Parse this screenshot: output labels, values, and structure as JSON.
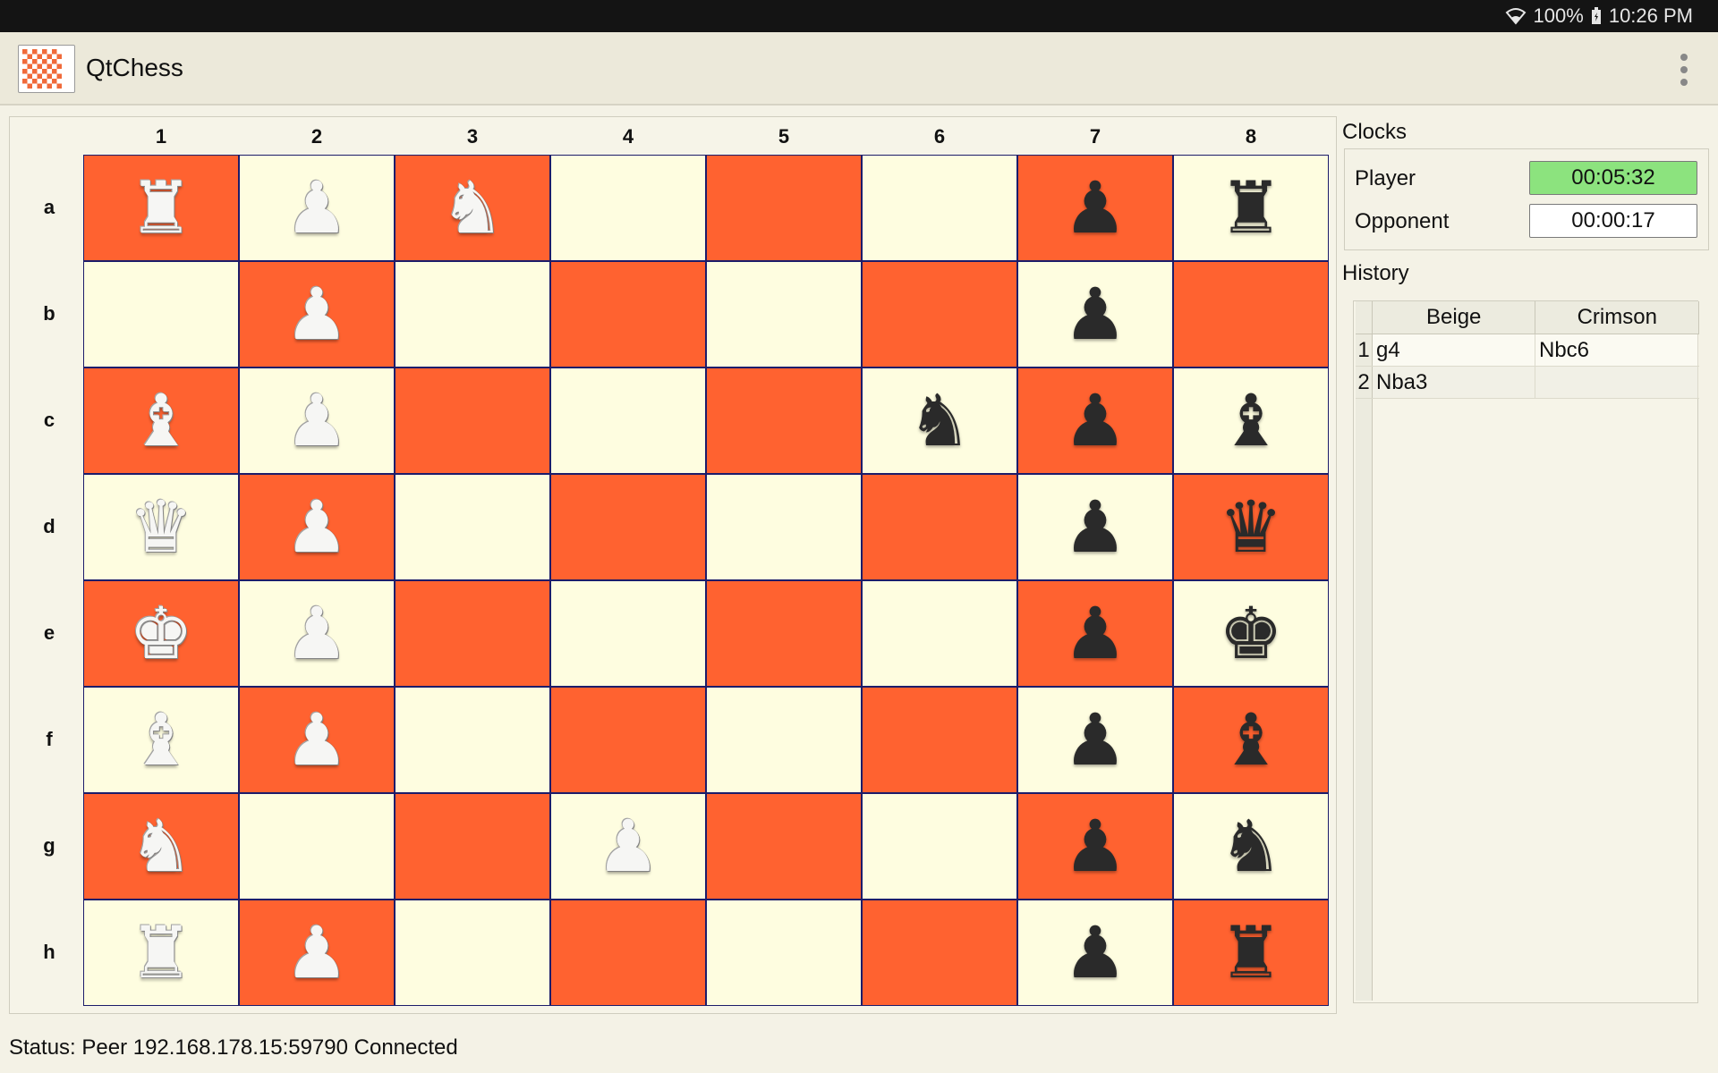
{
  "statusbar": {
    "battery": "100%",
    "time": "10:26 PM"
  },
  "app": {
    "title": "QtChess"
  },
  "board": {
    "columns": [
      "1",
      "2",
      "3",
      "4",
      "5",
      "6",
      "7",
      "8"
    ],
    "rows": [
      "a",
      "b",
      "c",
      "d",
      "e",
      "f",
      "g",
      "h"
    ],
    "pieces": [
      [
        "wR",
        "wP",
        "wN",
        "",
        "",
        "",
        "bP",
        "bR"
      ],
      [
        "",
        "wP",
        "",
        "",
        "",
        "",
        "bP",
        ""
      ],
      [
        "wB",
        "wP",
        "",
        "",
        "",
        "bN",
        "bP",
        "bB"
      ],
      [
        "wQ",
        "wP",
        "",
        "",
        "",
        "",
        "bP",
        "bQ"
      ],
      [
        "wK",
        "wP",
        "",
        "",
        "",
        "",
        "bP",
        "bK"
      ],
      [
        "wB",
        "wP",
        "",
        "",
        "",
        "",
        "bP",
        "bB"
      ],
      [
        "wN",
        "",
        "",
        "wP",
        "",
        "",
        "bP",
        "bN"
      ],
      [
        "wR",
        "wP",
        "",
        "",
        "",
        "",
        "bP",
        "bR"
      ]
    ]
  },
  "clocks": {
    "title": "Clocks",
    "player_label": "Player",
    "player_time": "00:05:32",
    "opponent_label": "Opponent",
    "opponent_time": "00:00:17"
  },
  "history": {
    "title": "History",
    "headers": [
      "Beige",
      "Crimson"
    ],
    "rows": [
      {
        "n": "1",
        "beige": "g4",
        "crimson": "Nbc6"
      },
      {
        "n": "2",
        "beige": "Nba3",
        "crimson": ""
      }
    ]
  },
  "status": "Status: Peer 192.168.178.15:59790 Connected",
  "colors": {
    "dark_square": "#ff6230",
    "light_square": "#fefde0",
    "active_clock": "#8ce37e"
  }
}
